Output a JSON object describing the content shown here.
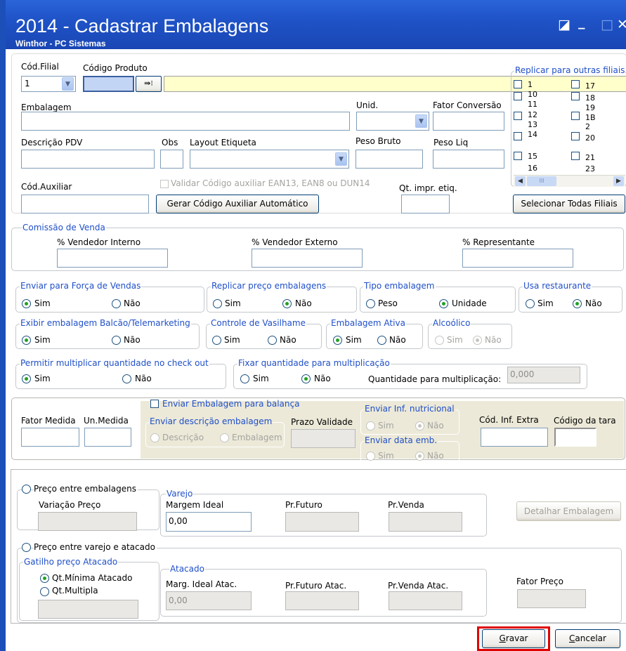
{
  "window": {
    "title": "2014 - Cadastrar Embalagens",
    "subtitle": "Winthor - PC Sistemas",
    "restore_glyph": "◪",
    "minimize_glyph": "_",
    "maximize_glyph": "□",
    "close_glyph": "✕"
  },
  "top": {
    "filial_label": "Cód.Filial",
    "filial_value": "1",
    "produto_label": "Código Produto",
    "embalagem_label": "Embalagem",
    "unid_label": "Unid.",
    "fator_label": "Fator Conversão",
    "descricao_pdv_label": "Descrição PDV",
    "obs_label": "Obs",
    "layout_label": "Layout Etiqueta",
    "peso_bruto_label": "Peso Bruto",
    "peso_liq_label": "Peso Liq",
    "cod_aux_label": "Cód.Auxiliar",
    "validar_label": "Validar Código auxiliar EAN13, EAN8 ou DUN14",
    "qt_impr_label": "Qt. impr. etiq.",
    "gerar_button": "Gerar Código Auxiliar Automático"
  },
  "replicar": {
    "legend": "Replicar para outras filiais",
    "col1": [
      "1",
      "10",
      "11",
      "12",
      "13",
      "14",
      "15",
      "16"
    ],
    "col2": [
      "17",
      "18",
      "19",
      "1B",
      "2",
      "20",
      "21",
      "23"
    ],
    "selecionar_button": "Selecionar Todas Filiais",
    "scroll_thumb": "III"
  },
  "comissao": {
    "legend": "Comissão de Venda",
    "interno_label": "% Vendedor Interno",
    "externo_label": "% Vendedor Externo",
    "representante_label": "% Representante"
  },
  "options": {
    "forca_vendas": {
      "legend": "Enviar para Força de Vendas",
      "sim": "Sim",
      "nao": "Não",
      "selected": "Sim"
    },
    "replicar_preco": {
      "legend": "Replicar preço embalagens",
      "sim": "Sim",
      "nao": "Não",
      "selected": "Não"
    },
    "tipo_embalagem": {
      "legend": "Tipo embalagem",
      "peso": "Peso",
      "unidade": "Unidade",
      "selected": "Unidade"
    },
    "usa_restaurante": {
      "legend": "Usa restaurante",
      "sim": "Sim",
      "nao": "Não",
      "selected": "Não"
    },
    "exibir_balcao": {
      "legend": "Exibir embalagem Balcão/Telemarketing",
      "sim": "Sim",
      "nao": "Não",
      "selected": "Sim"
    },
    "vasilhame": {
      "legend": "Controle de Vasilhame",
      "sim": "Sim",
      "nao": "Não",
      "selected": "none"
    },
    "ativa": {
      "legend": "Embalagem Ativa",
      "sim": "Sim",
      "nao": "Não",
      "selected": "Sim"
    },
    "alcoolico": {
      "legend": "Alcoólico",
      "sim": "Sim",
      "nao": "Não",
      "selected": "Não"
    },
    "multiplicar": {
      "legend": "Permitir multiplicar quantidade no check out",
      "sim": "Sim",
      "nao": "Não",
      "selected": "Sim"
    },
    "fixar": {
      "legend": "Fixar quantidade para multiplicação",
      "sim": "Sim",
      "nao": "Não",
      "selected": "Não",
      "qtd_label": "Quantidade para multiplicação:",
      "qtd_value": "0,000"
    }
  },
  "balanca": {
    "fator_medida_label": "Fator Medida",
    "un_medida_label": "Un.Medida",
    "enviar_label": "Enviar Embalagem para balança",
    "descricao_legend": "Enviar descrição embalagem",
    "descricao_opt": "Descrição",
    "embalagem_opt": "Embalagem",
    "prazo_label": "Prazo Validade",
    "nutricional_legend": "Enviar Inf. nutricional",
    "nutricional_sim": "Sim",
    "nutricional_nao": "Não",
    "data_legend": "Enviar data emb.",
    "data_sim": "Sim",
    "data_nao": "Não",
    "inf_extra_label": "Cód. Inf. Extra",
    "tara_label": "Código da tara"
  },
  "precos": {
    "entre_embalagens": "Preço entre embalagens",
    "variacao_label": "Variação Preço",
    "varejo_legend": "Varejo",
    "margem_label": "Margem Ideal",
    "margem_value": "0,00",
    "futuro_label": "Pr.Futuro",
    "venda_label": "Pr.Venda",
    "detalhar_button": "Detalhar Embalagem",
    "varejo_atacado": "Preço entre varejo e atacado",
    "gatilho_legend": "Gatilho preço Atacado",
    "qt_minima": "Qt.Mínima Atacado",
    "qt_multipla": "Qt.Multipla",
    "atacado_legend": "Atacado",
    "marg_atac_label": "Marg. Ideal Atac.",
    "marg_atac_value": "0,00",
    "futuro_atac_label": "Pr.Futuro Atac.",
    "venda_atac_label": "Pr.Venda Atac.",
    "fator_preco_label": "Fator Preço"
  },
  "footer": {
    "gravar_prefix": "G",
    "gravar_rest": "ravar",
    "cancelar_prefix": "C",
    "cancelar_rest": "ancelar"
  }
}
